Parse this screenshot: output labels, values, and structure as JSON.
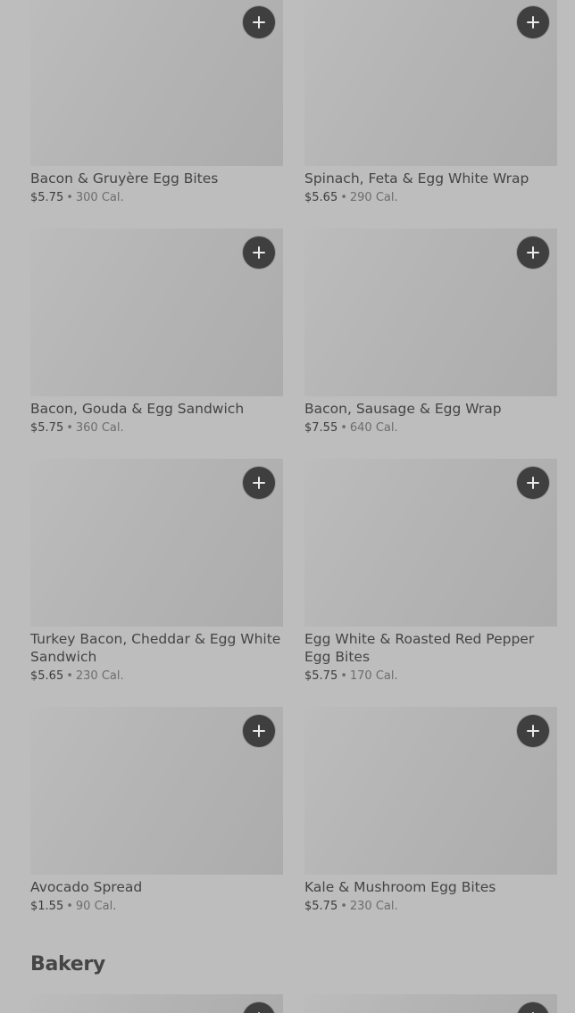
{
  "items": [
    {
      "name": "Bacon & Gruyère Egg Bites",
      "price": "$5.75",
      "calories": "300 Cal."
    },
    {
      "name": "Spinach, Feta & Egg White Wrap",
      "price": "$5.65",
      "calories": "290 Cal."
    },
    {
      "name": "Bacon, Gouda & Egg Sandwich",
      "price": "$5.75",
      "calories": "360 Cal."
    },
    {
      "name": "Bacon, Sausage & Egg Wrap",
      "price": "$7.55",
      "calories": "640 Cal."
    },
    {
      "name": "Turkey Bacon, Cheddar & Egg White Sandwich",
      "price": "$5.65",
      "calories": "230 Cal."
    },
    {
      "name": "Egg White & Roasted Red Pepper Egg Bites",
      "price": "$5.75",
      "calories": "170 Cal."
    },
    {
      "name": "Avocado Spread",
      "price": "$1.55",
      "calories": "90 Cal."
    },
    {
      "name": "Kale & Mushroom Egg Bites",
      "price": "$5.75",
      "calories": "230 Cal."
    }
  ],
  "separator": "•",
  "bakery": {
    "title": "Bakery"
  },
  "icons": {
    "add": "plus-icon"
  },
  "colors": {
    "overlay": "#bdbdbd",
    "button": "#3f3f3f"
  }
}
